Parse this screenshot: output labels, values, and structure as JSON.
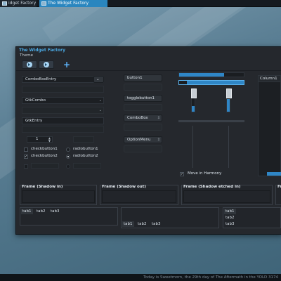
{
  "taskbar": {
    "tasks": [
      {
        "label": "idget Factory"
      },
      {
        "label": "The Widget Factory"
      }
    ]
  },
  "window": {
    "title": "The Widget Factory",
    "menu_label": "Theme"
  },
  "toolbar": {
    "icons": [
      "media-previous-icon",
      "media-rewind-icon",
      "add-icon"
    ],
    "add_label": "+"
  },
  "left": {
    "combo_entry": {
      "value": "ComboBoxEntry",
      "placeholder_text": ""
    },
    "gtk_combo": {
      "value": "GtkCombo"
    },
    "gtk_entry": {
      "value": "GtkEntry"
    },
    "spin": {
      "value": "1"
    },
    "check1": "checkbutton1",
    "check2": "checkbutton2",
    "radio1": "radiobutton1",
    "radio2": "radiobutton2"
  },
  "middle": {
    "button1": "button1",
    "toggle1": "togglebutton1",
    "combobox": "ComboBox",
    "optionmenu": "OptionMenu"
  },
  "sliders": {
    "move_label": "Move in Harmony",
    "h1_fill": 0.7,
    "h2_fill": 0.12,
    "v1_fill": 0.25,
    "v2_fill": 0.55
  },
  "tree": {
    "column": "Column1",
    "progress": 0.1
  },
  "frames": [
    {
      "title": "Frame (Shadow in)"
    },
    {
      "title": "Frame (Shadow out)"
    },
    {
      "title": "Frame (Shadow etched in)"
    },
    {
      "title": "Fr"
    }
  ],
  "notebooks": {
    "tabs": [
      "tab1",
      "tab2",
      "tab3"
    ]
  },
  "status": {
    "text": "Today is Sweetmorn, the 29th day of The Aftermath in the YOLD 3174"
  },
  "colors": {
    "accent": "#2f86c6",
    "title": "#4aa7e0"
  }
}
